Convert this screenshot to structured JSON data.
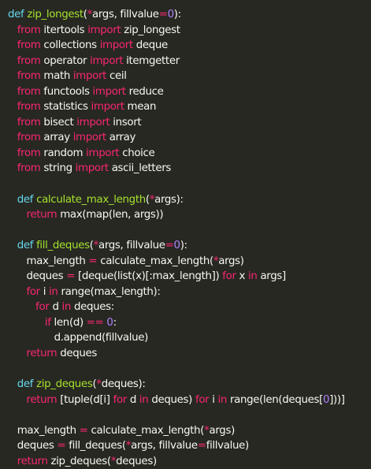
{
  "colors": {
    "background": "#272822",
    "text": "#f8f8f2",
    "keyword": "#f92672",
    "def": "#66d9ef",
    "function_name": "#a6e22e",
    "number": "#ae81ff"
  },
  "code": {
    "lines": [
      [
        [
          "def",
          "def"
        ],
        [
          "plain",
          " "
        ],
        [
          "fn",
          "zip_longest"
        ],
        [
          "plain",
          "("
        ],
        [
          "kw",
          "*"
        ],
        [
          "plain",
          "args, fillvalue"
        ],
        [
          "kw",
          "="
        ],
        [
          "num",
          "0"
        ],
        [
          "plain",
          "):"
        ]
      ],
      [
        [
          "plain",
          "   "
        ],
        [
          "kw",
          "from"
        ],
        [
          "plain",
          " itertools "
        ],
        [
          "kw",
          "import"
        ],
        [
          "plain",
          " zip_longest"
        ]
      ],
      [
        [
          "plain",
          "   "
        ],
        [
          "kw",
          "from"
        ],
        [
          "plain",
          " collections "
        ],
        [
          "kw",
          "import"
        ],
        [
          "plain",
          " deque"
        ]
      ],
      [
        [
          "plain",
          "   "
        ],
        [
          "kw",
          "from"
        ],
        [
          "plain",
          " operator "
        ],
        [
          "kw",
          "import"
        ],
        [
          "plain",
          " itemgetter"
        ]
      ],
      [
        [
          "plain",
          "   "
        ],
        [
          "kw",
          "from"
        ],
        [
          "plain",
          " math "
        ],
        [
          "kw",
          "import"
        ],
        [
          "plain",
          " ceil"
        ]
      ],
      [
        [
          "plain",
          "   "
        ],
        [
          "kw",
          "from"
        ],
        [
          "plain",
          " functools "
        ],
        [
          "kw",
          "import"
        ],
        [
          "plain",
          " reduce"
        ]
      ],
      [
        [
          "plain",
          "   "
        ],
        [
          "kw",
          "from"
        ],
        [
          "plain",
          " statistics "
        ],
        [
          "kw",
          "import"
        ],
        [
          "plain",
          " mean"
        ]
      ],
      [
        [
          "plain",
          "   "
        ],
        [
          "kw",
          "from"
        ],
        [
          "plain",
          " bisect "
        ],
        [
          "kw",
          "import"
        ],
        [
          "plain",
          " insort"
        ]
      ],
      [
        [
          "plain",
          "   "
        ],
        [
          "kw",
          "from"
        ],
        [
          "plain",
          " array "
        ],
        [
          "kw",
          "import"
        ],
        [
          "plain",
          " array"
        ]
      ],
      [
        [
          "plain",
          "   "
        ],
        [
          "kw",
          "from"
        ],
        [
          "plain",
          " random "
        ],
        [
          "kw",
          "import"
        ],
        [
          "plain",
          " choice"
        ]
      ],
      [
        [
          "plain",
          "   "
        ],
        [
          "kw",
          "from"
        ],
        [
          "plain",
          " string "
        ],
        [
          "kw",
          "import"
        ],
        [
          "plain",
          " ascii_letters"
        ]
      ],
      [
        [
          "plain",
          ""
        ]
      ],
      [
        [
          "plain",
          "   "
        ],
        [
          "def",
          "def"
        ],
        [
          "plain",
          " "
        ],
        [
          "fn",
          "calculate_max_length"
        ],
        [
          "plain",
          "("
        ],
        [
          "kw",
          "*"
        ],
        [
          "plain",
          "args):"
        ]
      ],
      [
        [
          "plain",
          "      "
        ],
        [
          "kw",
          "return"
        ],
        [
          "plain",
          " max(map(len, args))"
        ]
      ],
      [
        [
          "plain",
          ""
        ]
      ],
      [
        [
          "plain",
          "   "
        ],
        [
          "def",
          "def"
        ],
        [
          "plain",
          " "
        ],
        [
          "fn",
          "fill_deques"
        ],
        [
          "plain",
          "("
        ],
        [
          "kw",
          "*"
        ],
        [
          "plain",
          "args, fillvalue"
        ],
        [
          "kw",
          "="
        ],
        [
          "num",
          "0"
        ],
        [
          "plain",
          "):"
        ]
      ],
      [
        [
          "plain",
          "      max_length "
        ],
        [
          "kw",
          "="
        ],
        [
          "plain",
          " calculate_max_length("
        ],
        [
          "kw",
          "*"
        ],
        [
          "plain",
          "args)"
        ]
      ],
      [
        [
          "plain",
          "      deques "
        ],
        [
          "kw",
          "="
        ],
        [
          "plain",
          " [deque(list(x)[:max_length]) "
        ],
        [
          "kw",
          "for"
        ],
        [
          "plain",
          " x "
        ],
        [
          "kw",
          "in"
        ],
        [
          "plain",
          " args]"
        ]
      ],
      [
        [
          "plain",
          "      "
        ],
        [
          "kw",
          "for"
        ],
        [
          "plain",
          " i "
        ],
        [
          "kw",
          "in"
        ],
        [
          "plain",
          " range(max_length):"
        ]
      ],
      [
        [
          "plain",
          "         "
        ],
        [
          "kw",
          "for"
        ],
        [
          "plain",
          " d "
        ],
        [
          "kw",
          "in"
        ],
        [
          "plain",
          " deques:"
        ]
      ],
      [
        [
          "plain",
          "            "
        ],
        [
          "kw",
          "if"
        ],
        [
          "plain",
          " len(d) "
        ],
        [
          "kw",
          "=="
        ],
        [
          "plain",
          " "
        ],
        [
          "num",
          "0"
        ],
        [
          "plain",
          ":"
        ]
      ],
      [
        [
          "plain",
          "               d.append(fillvalue)"
        ]
      ],
      [
        [
          "plain",
          "      "
        ],
        [
          "kw",
          "return"
        ],
        [
          "plain",
          " deques"
        ]
      ],
      [
        [
          "plain",
          ""
        ]
      ],
      [
        [
          "plain",
          "   "
        ],
        [
          "def",
          "def"
        ],
        [
          "plain",
          " "
        ],
        [
          "fn",
          "zip_deques"
        ],
        [
          "plain",
          "("
        ],
        [
          "kw",
          "*"
        ],
        [
          "plain",
          "deques):"
        ]
      ],
      [
        [
          "plain",
          "      "
        ],
        [
          "kw",
          "return"
        ],
        [
          "plain",
          " [tuple(d[i] "
        ],
        [
          "kw",
          "for"
        ],
        [
          "plain",
          " d "
        ],
        [
          "kw",
          "in"
        ],
        [
          "plain",
          " deques) "
        ],
        [
          "kw",
          "for"
        ],
        [
          "plain",
          " i "
        ],
        [
          "kw",
          "in"
        ],
        [
          "plain",
          " range(len(deques["
        ],
        [
          "num",
          "0"
        ],
        [
          "plain",
          "]))]"
        ]
      ],
      [
        [
          "plain",
          ""
        ]
      ],
      [
        [
          "plain",
          "   max_length "
        ],
        [
          "kw",
          "="
        ],
        [
          "plain",
          " calculate_max_length("
        ],
        [
          "kw",
          "*"
        ],
        [
          "plain",
          "args)"
        ]
      ],
      [
        [
          "plain",
          "   deques "
        ],
        [
          "kw",
          "="
        ],
        [
          "plain",
          " fill_deques("
        ],
        [
          "kw",
          "*"
        ],
        [
          "plain",
          "args, fillvalue"
        ],
        [
          "kw",
          "="
        ],
        [
          "plain",
          "fillvalue)"
        ]
      ],
      [
        [
          "plain",
          "   "
        ],
        [
          "kw",
          "return"
        ],
        [
          "plain",
          " zip_deques("
        ],
        [
          "kw",
          "*"
        ],
        [
          "plain",
          "deques)"
        ]
      ]
    ]
  }
}
